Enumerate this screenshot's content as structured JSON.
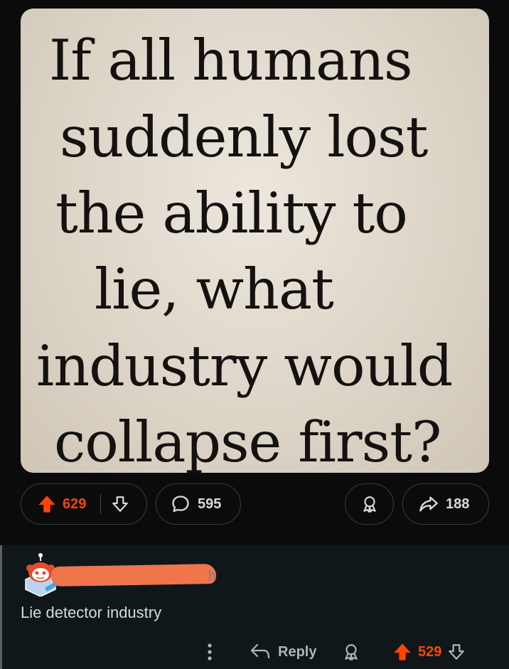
{
  "post": {
    "image_text_lines": [
      "If all humans",
      "suddenly lost",
      "the ability to",
      "lie, what",
      "industry would",
      "collapse first?"
    ],
    "upvotes": "629",
    "comments": "595",
    "shares": "188"
  },
  "comment": {
    "username_fragment": "h",
    "body": "Lie detector industry",
    "reply_label": "Reply",
    "score": "529"
  },
  "colors": {
    "upvote_accent": "#ff4500",
    "redaction": "#f0754b",
    "comment_bg": "#0f171b",
    "page_bg": "#0b0b0c"
  },
  "icons": [
    "upvote-icon",
    "downvote-icon",
    "comment-bubble-icon",
    "award-icon",
    "share-icon",
    "more-icon",
    "reply-icon",
    "avatar-icon"
  ]
}
